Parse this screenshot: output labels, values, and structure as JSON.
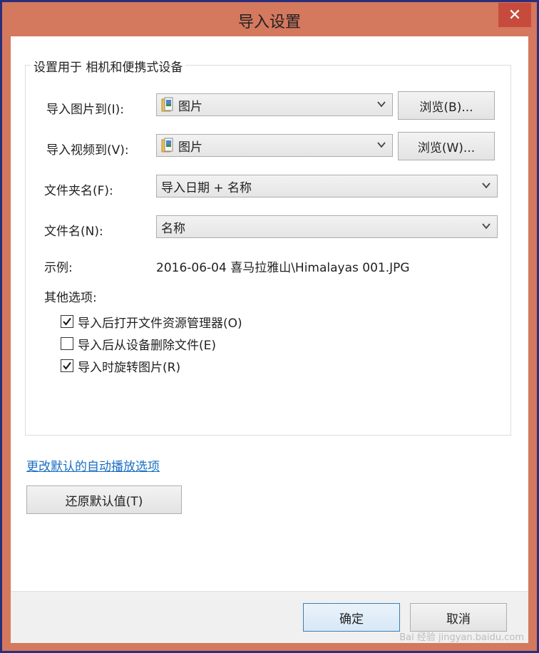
{
  "window": {
    "title": "导入设置",
    "close_glyph": "✕"
  },
  "group": {
    "legend": "设置用于  相机和便携式设备"
  },
  "import_pictures": {
    "label": "导入图片到(I):",
    "value": "图片",
    "browse_label": "浏览(B)..."
  },
  "import_videos": {
    "label": "导入视频到(V):",
    "value": "图片",
    "browse_label": "浏览(W)..."
  },
  "folder_name": {
    "label": "文件夹名(F):",
    "value": "导入日期 + 名称"
  },
  "file_name": {
    "label": "文件名(N):",
    "value": "名称"
  },
  "example": {
    "label": "示例:",
    "value": "2016-06-04 喜马拉雅山\\Himalayas 001.JPG"
  },
  "other_options": {
    "label": "其他选项:",
    "items": [
      {
        "label": "导入后打开文件资源管理器(O)",
        "checked": true
      },
      {
        "label": "导入后从设备删除文件(E)",
        "checked": false
      },
      {
        "label": "导入时旋转图片(R)",
        "checked": true
      }
    ]
  },
  "autoplay_link": "更改默认的自动播放选项",
  "restore_button": "还原默认值(T)",
  "footer": {
    "ok": "确定",
    "cancel": "取消"
  },
  "watermark": "Bai 经验 jingyan.baidu.com",
  "icons": {
    "folder": "folder-icon",
    "chevron": "chevron-down-icon",
    "check": "check-icon",
    "close": "close-icon"
  }
}
